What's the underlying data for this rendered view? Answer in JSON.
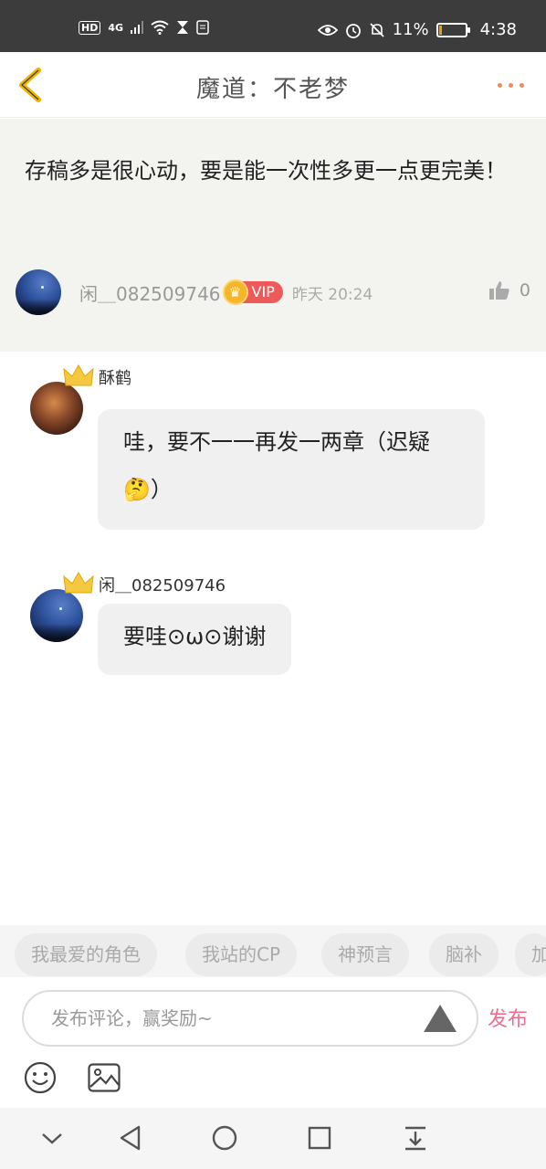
{
  "status_bar": {
    "hd_label": "HD",
    "network": "4G",
    "battery_percent": "11%",
    "battery_level": 0.11,
    "time": "4:38"
  },
  "header": {
    "title": "魔道：不老梦"
  },
  "main_comment": {
    "text": "存稿多是很心动，要是能一次性多更一点更完美！",
    "author": "闲＿082509746",
    "vip_label": "VIP",
    "time": "昨天 20:24",
    "like_count": "0"
  },
  "replies": [
    {
      "name": "酥鹤",
      "text": "哇，要不一一再发一两章（迟疑🤔）"
    },
    {
      "name": "闲＿082509746",
      "text": "要哇⊙ω⊙谢谢"
    }
  ],
  "tags": [
    "我最爱的角色",
    "我站的CP",
    "神预言",
    "脑补",
    "加"
  ],
  "input": {
    "placeholder": "发布评论，赢奖励~",
    "send_label": "发布"
  },
  "colors": {
    "accent": "#ee6e8e",
    "vip_red": "#ee5a5a",
    "crown_gold": "#f7b62a",
    "back_arrow": "#f0b400"
  }
}
